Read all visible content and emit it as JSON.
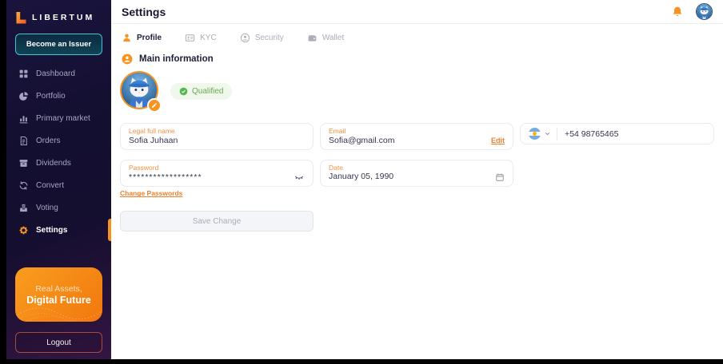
{
  "brand": {
    "name": "LIBERTUM"
  },
  "sidebar": {
    "issuer_button": "Become an Issuer",
    "items": [
      {
        "label": "Dashboard"
      },
      {
        "label": "Portfolio"
      },
      {
        "label": "Primary market"
      },
      {
        "label": "Orders"
      },
      {
        "label": "Dividends"
      },
      {
        "label": "Convert"
      },
      {
        "label": "Voting"
      },
      {
        "label": "Settings"
      }
    ],
    "promo": {
      "line1": "Real Assets,",
      "line2": "Digital Future"
    },
    "logout_label": "Logout"
  },
  "header": {
    "title": "Settings"
  },
  "tabs": [
    {
      "label": "Profile"
    },
    {
      "label": "KYC"
    },
    {
      "label": "Security"
    },
    {
      "label": "Wallet"
    }
  ],
  "profile": {
    "section_title": "Main information",
    "qualified_badge": "Qualified"
  },
  "form": {
    "legal_name": {
      "label": "Legal full name",
      "value": "Sofia Juhaan"
    },
    "email": {
      "label": "Email",
      "value": "Sofia@gmail.com",
      "action_label": "Edit"
    },
    "phone": {
      "value": "+54 98765465"
    },
    "password": {
      "label": "Password",
      "value": "******************"
    },
    "date": {
      "label": "Date",
      "value": "January 05, 1990"
    },
    "change_password_label": "Change Passwords",
    "save_label": "Save Change"
  },
  "colors": {
    "accent": "#F7931E",
    "teal": "#3FC3D6",
    "green": "#5CB649",
    "label_orange": "#F5923E"
  }
}
